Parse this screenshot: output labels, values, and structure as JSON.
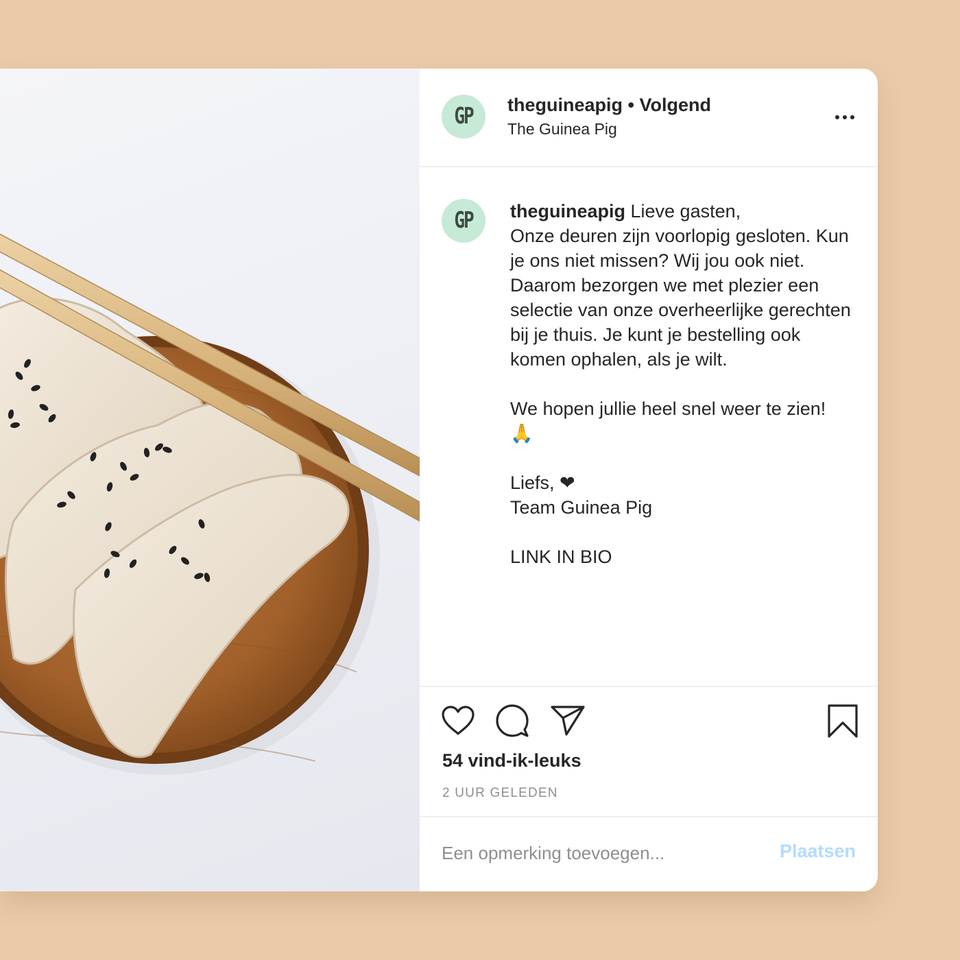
{
  "post": {
    "image_alt": "Dumplings met sesamzaad op een houten bord met eetstokjes",
    "header": {
      "avatar_initials": "GP",
      "username": "theguineapig",
      "separator": " • ",
      "follow_label": "Volgend",
      "subtitle": "The Guinea Pig",
      "more_icon": "more-horizontal-icon"
    },
    "caption": {
      "avatar_initials": "GP",
      "username": "theguineapig",
      "text": " Lieve gasten,\nOnze deuren zijn voorlopig gesloten. Kun je ons niet missen? Wij jou ook niet. Daarom bezorgen we met plezier een selectie van onze overheerlijke gerechten bij je thuis. Je kunt je bestelling ook komen ophalen, als je wilt.\n\nWe hopen jullie heel snel weer te zien! 🙏\n\nLiefs, ❤\nTeam Guinea Pig\n\nLINK IN BIO"
    },
    "actions": {
      "like_icon": "heart-icon",
      "comment_icon": "comment-bubble-icon",
      "share_icon": "paper-plane-icon",
      "save_icon": "bookmark-icon"
    },
    "likes": "54 vind-ik-leuks",
    "timestamp": "2 UUR GELEDEN",
    "comment": {
      "placeholder": "Een opmerking toevoegen...",
      "value": "",
      "post_label": "Plaatsen"
    }
  },
  "colors": {
    "background": "#ebcaa9",
    "avatar": "#c6ead6",
    "post_button_disabled": "#b3dbff",
    "muted_text": "#8e8e8e"
  }
}
